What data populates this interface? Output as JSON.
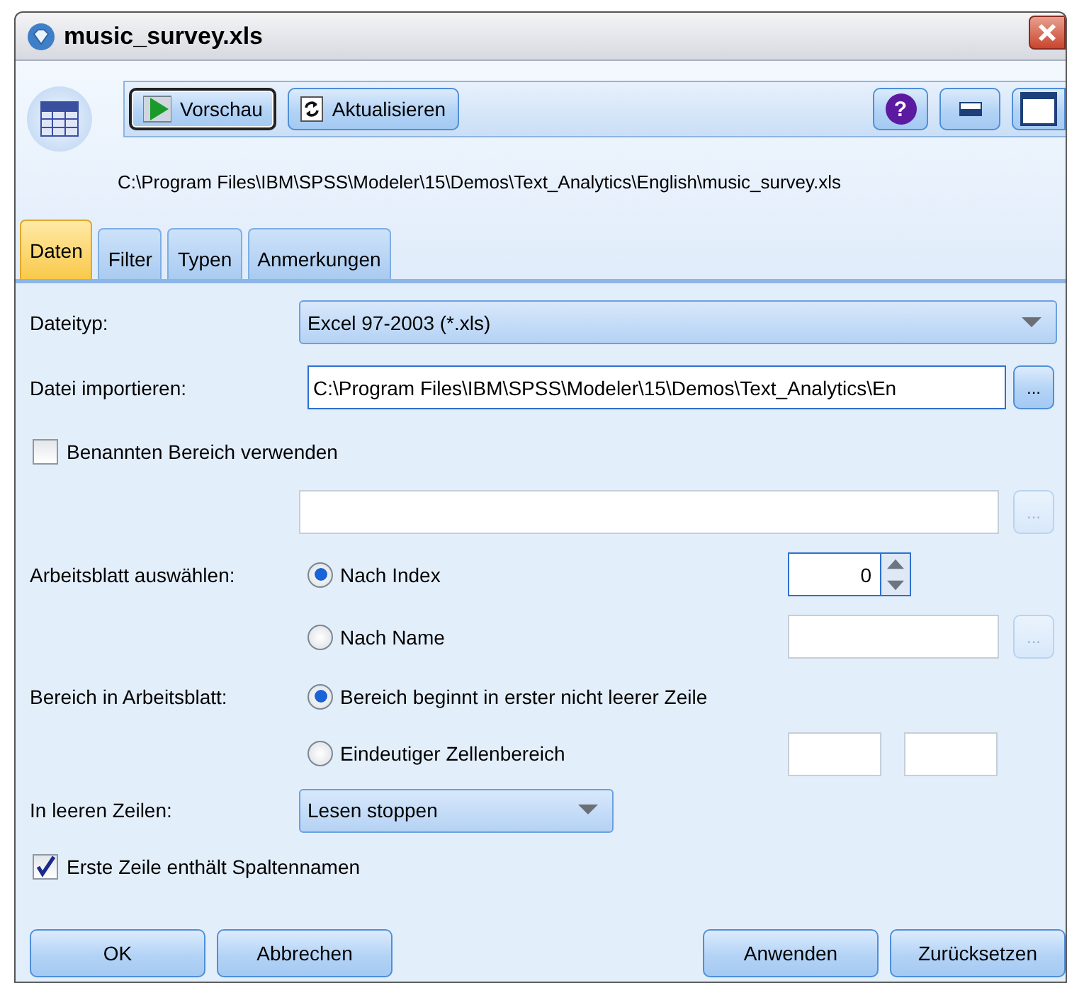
{
  "window": {
    "title": "music_survey.xls"
  },
  "toolbar": {
    "buttons": [
      {
        "kind": "preview",
        "label": "Vorschau",
        "focused": true
      },
      {
        "kind": "refresh",
        "label": "Aktualisieren",
        "focused": false
      }
    ],
    "help": {
      "label": "?"
    }
  },
  "path": "C:\\Program Files\\IBM\\SPSS\\Modeler\\15\\Demos\\Text_Analytics\\English\\music_survey.xls",
  "tabs": [
    {
      "label": "Daten",
      "selected": true
    },
    {
      "label": "Filter",
      "selected": false
    },
    {
      "label": "Typen",
      "selected": false
    },
    {
      "label": "Anmerkungen",
      "selected": false
    }
  ],
  "form": [
    {
      "kind": "dropdown",
      "label": "Dateityp:",
      "value": "Excel 97-2003 (*.xls)",
      "wide": true
    },
    {
      "kind": "file",
      "label": "Datei importieren:",
      "value": "C:\\Program Files\\IBM\\SPSS\\Modeler\\15\\Demos\\Text_Analytics\\En",
      "button": {
        "label": "...",
        "disabled": false
      }
    },
    {
      "kind": "checkbox",
      "label": "Benannten Bereich verwenden",
      "checked": false
    },
    {
      "kind": "field",
      "button": {
        "label": "...",
        "disabled": true
      }
    },
    {
      "kind": "radio",
      "label": "Arbeitsblatt auswählen:",
      "option": "Nach Index",
      "selected": true,
      "extra": {
        "kind": "spinner",
        "value": "0"
      }
    },
    {
      "kind": "radio",
      "option": "Nach Name",
      "selected": false,
      "extra": {
        "kind": "field",
        "button": {
          "label": "...",
          "disabled": true
        }
      }
    },
    {
      "kind": "radio",
      "label": "Bereich in Arbeitsblatt:",
      "option": "Bereich beginnt in erster nicht leerer Zeile",
      "selected": true
    },
    {
      "kind": "radio",
      "option": "Eindeutiger Zellenbereich",
      "selected": false,
      "extra": {
        "kind": "pair"
      }
    },
    {
      "kind": "dropdown",
      "label": "In leeren Zeilen:",
      "value": "Lesen stoppen",
      "wide": false
    },
    {
      "kind": "checkbox",
      "label": "Erste Zeile enthält Spaltennamen",
      "checked": true
    }
  ],
  "buttons": {
    "left": [
      "OK",
      "Abbrechen"
    ],
    "right": [
      "Anwenden",
      "Zurücksetzen"
    ]
  }
}
